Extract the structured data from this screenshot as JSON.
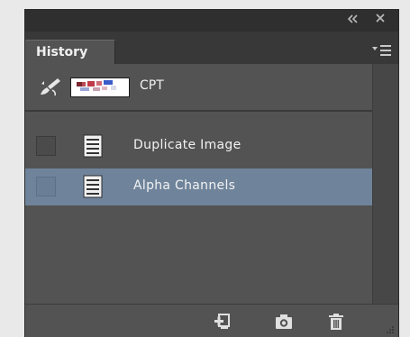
{
  "panel": {
    "tab_label": "History",
    "collapse_icon": "double-chevron-left-icon",
    "close_icon": "close-icon",
    "menu_icon": "panel-menu-icon"
  },
  "snapshot": {
    "label": "CPT",
    "icon": "history-brush-icon"
  },
  "history_states": [
    {
      "label": "Duplicate Image",
      "icon": "document-state-icon",
      "selected": false
    },
    {
      "label": "Alpha Channels",
      "icon": "document-state-icon",
      "selected": true
    }
  ],
  "footer": {
    "buttons": [
      "new-document-from-state-icon",
      "camera-icon",
      "trash-icon"
    ]
  },
  "colors": {
    "panel_bg": "#535353",
    "selection": "#6f849b",
    "text": "#f2f2f2"
  }
}
